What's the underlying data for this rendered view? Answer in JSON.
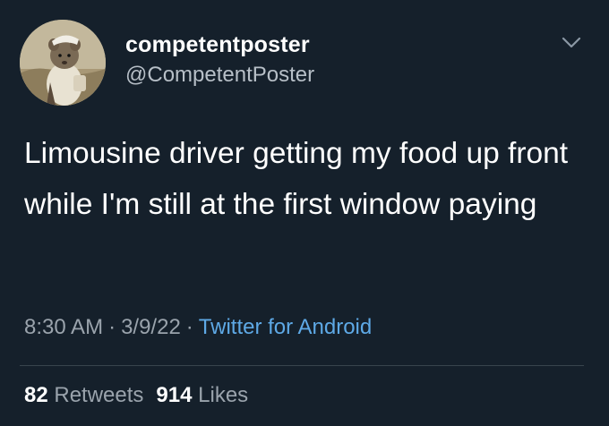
{
  "user": {
    "display_name": "competentposter",
    "handle": "@CompetentPoster",
    "avatar_icon": "avatar-rat-illustration"
  },
  "menu_icon": "chevron-down-icon",
  "tweet": {
    "text": "Limousine driver getting my food up front while I'm still at the first window paying"
  },
  "meta": {
    "time": "8:30 AM",
    "date": "3/9/22",
    "separator": "·",
    "source": "Twitter for Android"
  },
  "stats": {
    "retweets_count": "82",
    "retweets_label": "Retweets",
    "likes_count": "914",
    "likes_label": "Likes"
  },
  "colors": {
    "background": "#15202b",
    "link": "#5ea9e6",
    "muted": "#9aa3ac",
    "divider": "#38444d"
  }
}
